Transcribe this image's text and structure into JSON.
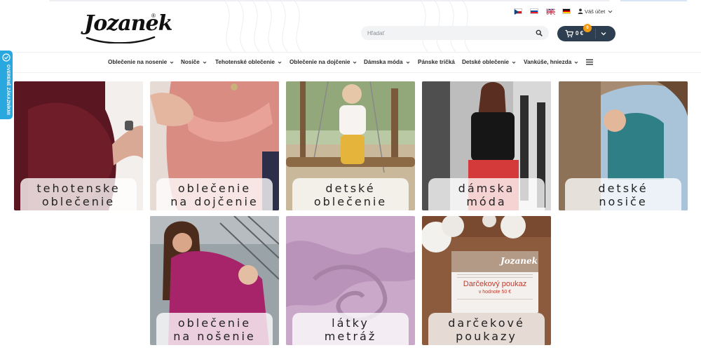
{
  "logo": {
    "text": "Jozanek",
    "reg": "®"
  },
  "search": {
    "placeholder": "Hľadať"
  },
  "cart": {
    "amount": "0 €",
    "badge": "0"
  },
  "account": {
    "label": "Váš účet"
  },
  "flags": [
    {
      "name": "flag-cz",
      "colors": [
        "#ffffff",
        "#d7141a",
        "#11457e"
      ]
    },
    {
      "name": "flag-sk",
      "colors": [
        "#ffffff",
        "#0b4ea2",
        "#ee1c25"
      ]
    },
    {
      "name": "flag-en",
      "colors": [
        "#012169",
        "#ffffff",
        "#c8102e"
      ]
    },
    {
      "name": "flag-de",
      "colors": [
        "#000000",
        "#dd0000",
        "#ffce00"
      ]
    }
  ],
  "nav": {
    "items": [
      {
        "label": "Oblečenie na nosenie",
        "dropdown": true
      },
      {
        "label": "Nosiče",
        "dropdown": true
      },
      {
        "label": "Tehotenské oblečenie",
        "dropdown": true
      },
      {
        "label": "Oblečenie na dojčenie",
        "dropdown": true
      },
      {
        "label": "Dámska móda",
        "dropdown": true
      },
      {
        "label": "Pánske tričká",
        "dropdown": false
      },
      {
        "label": "Detské oblečenie",
        "dropdown": true
      },
      {
        "label": "Vankúše, hniezda",
        "dropdown": true
      }
    ]
  },
  "side_tab": {
    "label": "OVERENÉ ZÁKAZNÍKMI"
  },
  "tiles": [
    {
      "line1": "tehotenske",
      "line2": "oblečenie"
    },
    {
      "line1": "oblečenie",
      "line2": "na dojčenie"
    },
    {
      "line1": "detské",
      "line2": "oblečenie"
    },
    {
      "line1": "dámska",
      "line2": "móda"
    },
    {
      "line1": "detské",
      "line2": "nosiče"
    },
    {
      "line1": "oblečenie",
      "line2": "na nošenie"
    },
    {
      "line1": "látky",
      "line2": "metráž"
    },
    {
      "line1": "darčekové",
      "line2": "poukazy"
    }
  ],
  "voucher": {
    "brand": "Jozanek",
    "title": "Darčekový poukaz",
    "value": "v hodnote 50 €"
  },
  "colors": {
    "accent": "#2c3e50",
    "badge": "#f39c12",
    "side_tab": "#29a8e0"
  }
}
